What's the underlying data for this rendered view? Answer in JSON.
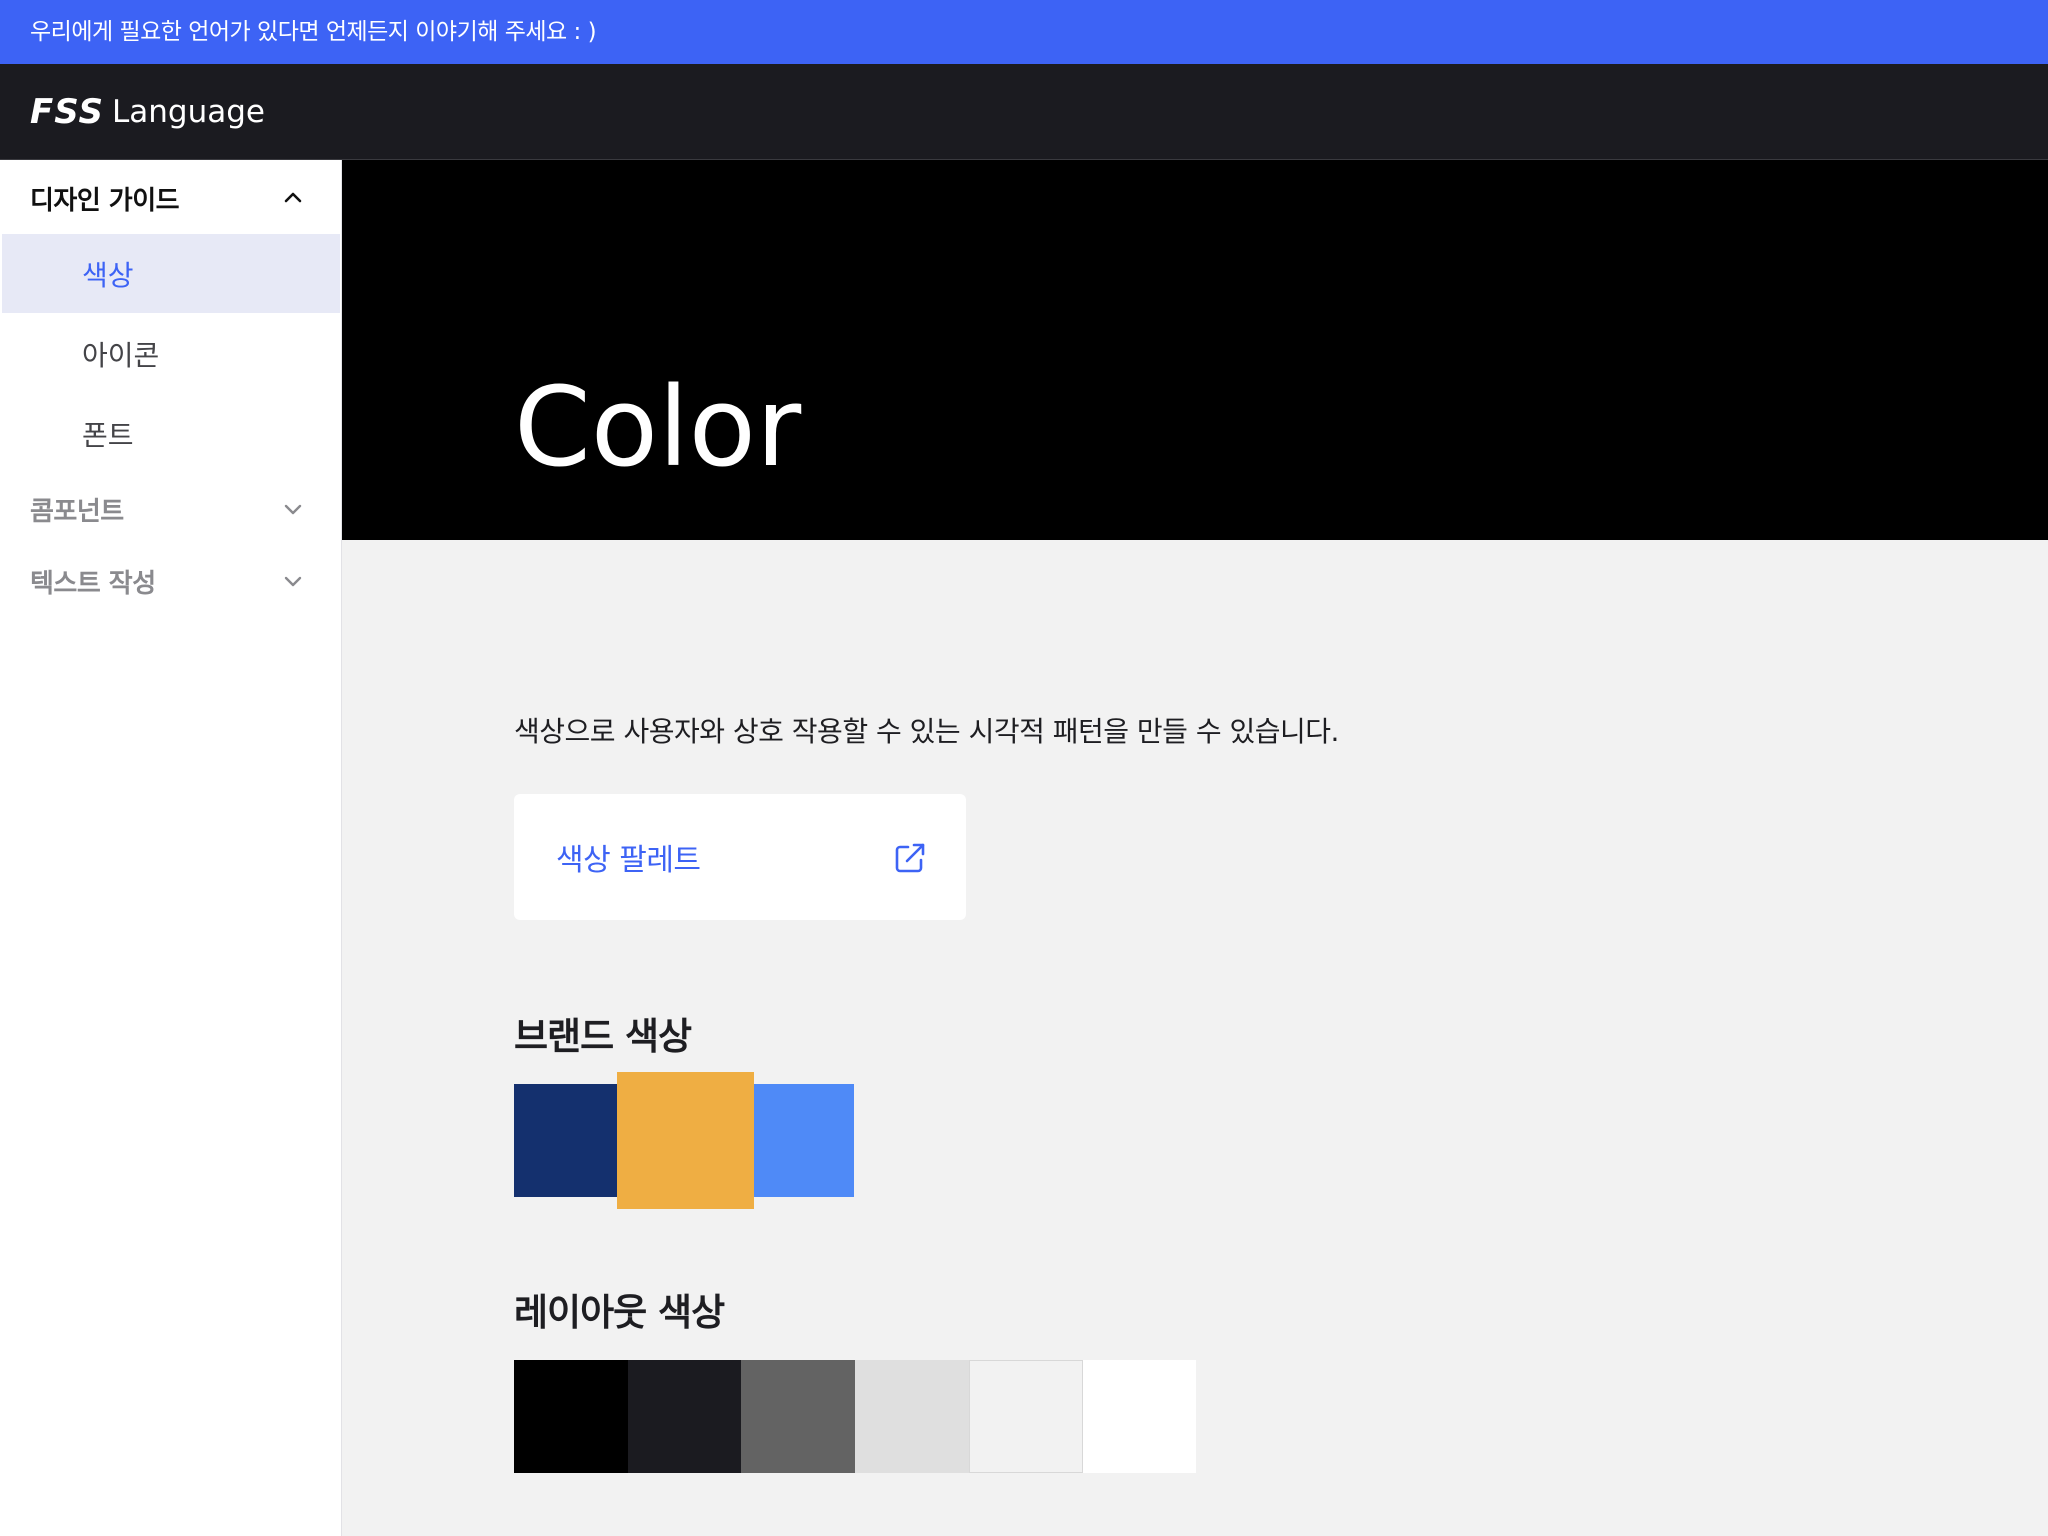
{
  "banner": {
    "text": "우리에게 필요한 언어가 있다면 언제든지 이야기해 주세요 : )"
  },
  "header": {
    "logo_mark": "FSS",
    "logo_text": "Language"
  },
  "sidebar": {
    "groups": [
      {
        "title": "디자인 가이드",
        "expanded": true,
        "icon": "chevron-up-icon",
        "items": [
          {
            "label": "색상",
            "active": true
          },
          {
            "label": "아이콘",
            "active": false
          },
          {
            "label": "폰트",
            "active": false
          }
        ]
      },
      {
        "title": "콤포넌트",
        "expanded": false,
        "icon": "chevron-down-icon"
      },
      {
        "title": "텍스트 작성",
        "expanded": false,
        "icon": "chevron-down-icon"
      }
    ]
  },
  "hero": {
    "title": "Color"
  },
  "main": {
    "description": "색상으로 사용자와 상호 작용할 수 있는 시각적 패턴을 만들 수 있습니다.",
    "palette_link": {
      "label": "색상 팔레트",
      "icon": "external-link-icon"
    },
    "brand_section": {
      "title": "브랜드 색상",
      "colors": [
        "#14306e",
        "#efae43",
        "#4f8af7"
      ],
      "highlighted_index": 1
    },
    "layout_section": {
      "title": "레이아웃 색상",
      "colors": [
        "#000000",
        "#1b1b20",
        "#636363",
        "#dfdfdf",
        "#f2f2f2",
        "#ffffff"
      ]
    }
  },
  "colors": {
    "accent": "#3d63f5",
    "topbar": "#1b1b20",
    "active_item_bg": "#e7e9f6",
    "content_bg": "#f2f2f2"
  }
}
